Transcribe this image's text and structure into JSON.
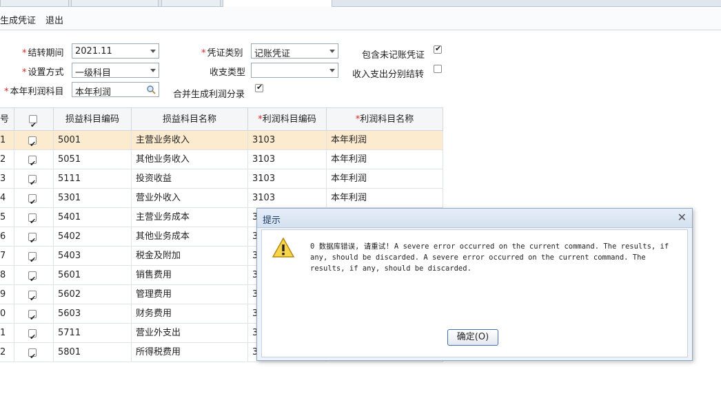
{
  "toolbar": {
    "generate_label": "生成凭证",
    "exit_label": "退出"
  },
  "form": {
    "period_label": "结转期间",
    "period_value": "2021.11",
    "voucher_type_label": "凭证类别",
    "voucher_type_value": "记账凭证",
    "include_unposted_label": "包含未记账凭证",
    "include_unposted_checked": true,
    "setup_label": "设置方式",
    "setup_value": "一级科目",
    "income_type_label": "收支类型",
    "income_type_value": "",
    "separate_label": "收入支出分别结转",
    "separate_checked": false,
    "profit_account_label": "本年利润科目",
    "profit_account_value": "本年利润",
    "merge_label": "合并生成利润分录",
    "merge_checked": true
  },
  "grid": {
    "headers": [
      "号",
      "",
      "损益科目编码",
      "损益科目名称",
      "利润科目编码",
      "利润科目名称"
    ],
    "rows": [
      {
        "no": "1",
        "code": "5001",
        "name": "主营业务收入",
        "pcode": "3103",
        "pname": "本年利润"
      },
      {
        "no": "2",
        "code": "5051",
        "name": "其他业务收入",
        "pcode": "3103",
        "pname": "本年利润"
      },
      {
        "no": "3",
        "code": "5111",
        "name": "投资收益",
        "pcode": "3103",
        "pname": "本年利润"
      },
      {
        "no": "4",
        "code": "5301",
        "name": "营业外收入",
        "pcode": "3103",
        "pname": "本年利润"
      },
      {
        "no": "5",
        "code": "5401",
        "name": "主营业务成本",
        "pcode": "3",
        "pname": ""
      },
      {
        "no": "6",
        "code": "5402",
        "name": "其他业务成本",
        "pcode": "3",
        "pname": ""
      },
      {
        "no": "7",
        "code": "5403",
        "name": "税金及附加",
        "pcode": "3",
        "pname": ""
      },
      {
        "no": "8",
        "code": "5601",
        "name": "销售费用",
        "pcode": "3",
        "pname": ""
      },
      {
        "no": "9",
        "code": "5602",
        "name": "管理费用",
        "pcode": "3",
        "pname": ""
      },
      {
        "no": "0",
        "code": "5603",
        "name": "财务费用",
        "pcode": "3",
        "pname": ""
      },
      {
        "no": "1",
        "code": "5711",
        "name": "营业外支出",
        "pcode": "3",
        "pname": ""
      },
      {
        "no": "2",
        "code": "5801",
        "name": "所得税费用",
        "pcode": "3",
        "pname": ""
      }
    ]
  },
  "dialog": {
    "title": "提示",
    "message": "0 数据库错误, 请重试! A severe error occurred on the current command. The results, if any, should be discarded. A severe error occurred on the current command. The results, if any, should be discarded.",
    "ok_label": "确定(O)"
  },
  "colors": {
    "selected_row": "#fdebd0",
    "required": "#e02020",
    "dialog_border": "#8fa6c2"
  }
}
